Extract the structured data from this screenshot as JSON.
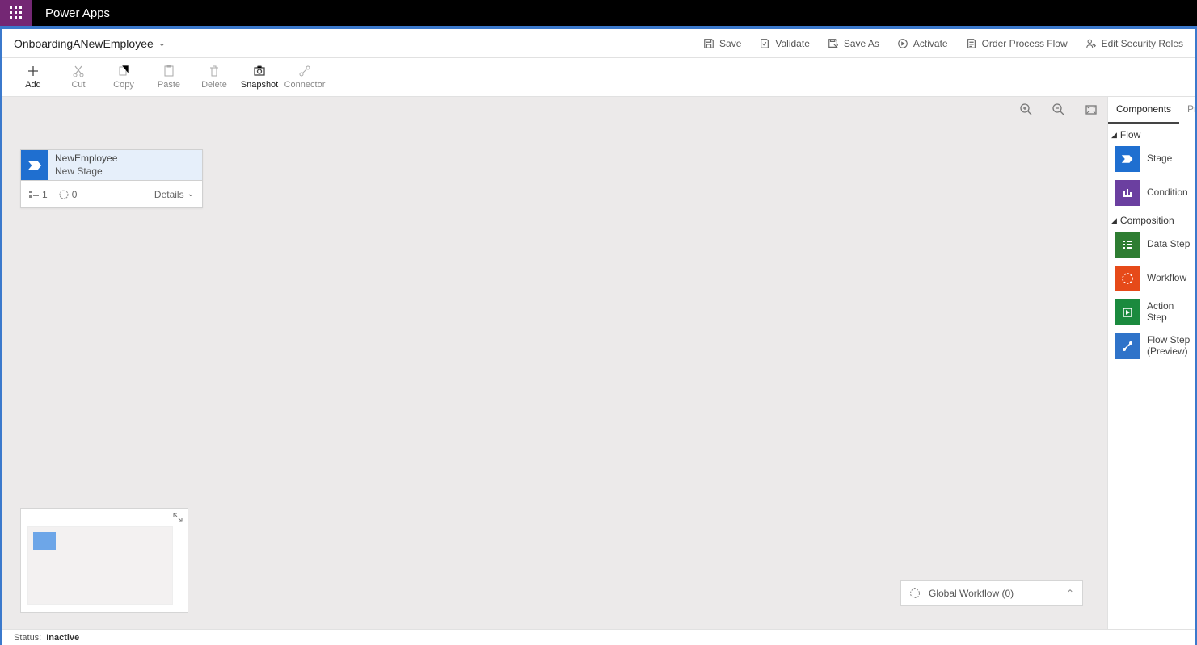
{
  "brand": "Power Apps",
  "processName": "OnboardingANewEmployee",
  "headerActions": {
    "save": "Save",
    "validate": "Validate",
    "saveAs": "Save As",
    "activate": "Activate",
    "order": "Order Process Flow",
    "security": "Edit Security Roles"
  },
  "toolbar": {
    "add": "Add",
    "cut": "Cut",
    "copy": "Copy",
    "paste": "Paste",
    "delete": "Delete",
    "snapshot": "Snapshot",
    "connector": "Connector"
  },
  "stage": {
    "entity": "NewEmployee",
    "name": "New Stage",
    "steps": "1",
    "workflows": "0",
    "details": "Details"
  },
  "globalWorkflow": "Global Workflow (0)",
  "componentsPanel": {
    "tab1": "Components",
    "tab2": "Pr",
    "flowHeader": "Flow",
    "compositionHeader": "Composition",
    "items": {
      "stage": "Stage",
      "condition": "Condition",
      "dataStep": "Data Step",
      "workflow": "Workflow",
      "actionStep": "Action Step",
      "flowStep": "Flow Step (Preview)"
    }
  },
  "status": {
    "label": "Status:",
    "value": "Inactive"
  }
}
